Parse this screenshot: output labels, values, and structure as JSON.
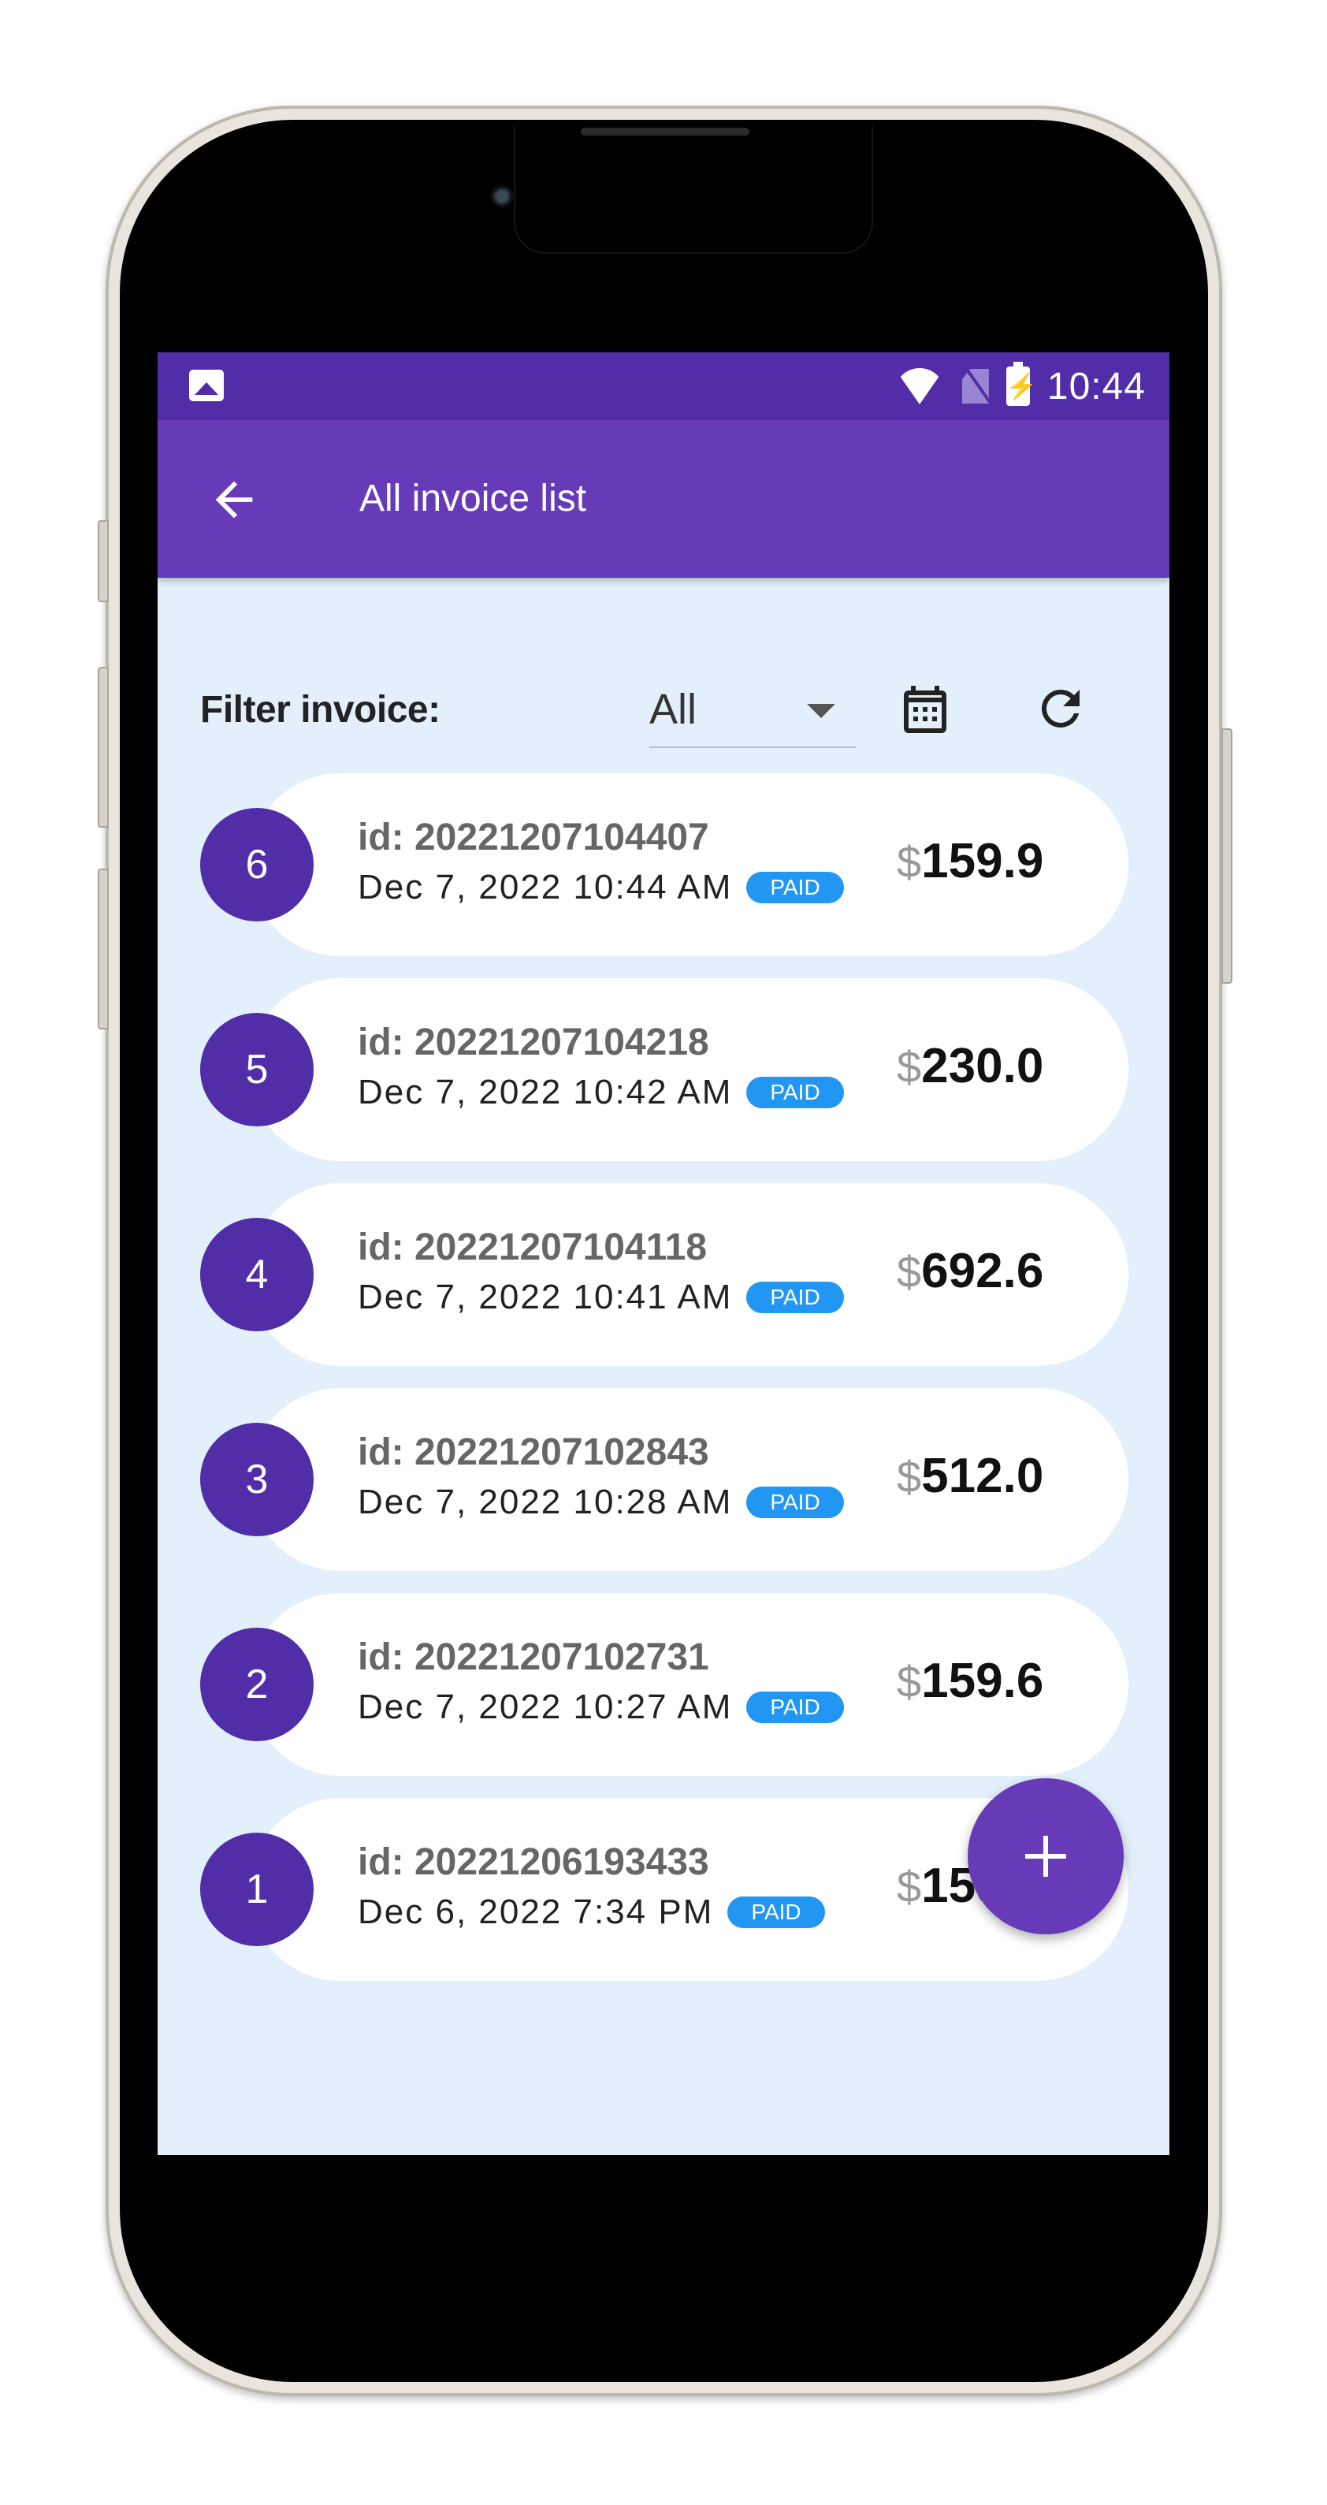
{
  "status_bar": {
    "time": "10:44",
    "icons": [
      "gallery-icon",
      "wifi-icon",
      "no-sim-icon",
      "battery-charging-icon"
    ]
  },
  "app_bar": {
    "title": "All invoice list",
    "back_icon": "arrow-back-icon"
  },
  "filter": {
    "label": "Filter invoice:",
    "selected": "All",
    "calendar_icon": "calendar-icon",
    "refresh_icon": "refresh-icon"
  },
  "invoices": [
    {
      "number": "6",
      "id": "id: 20221207104407",
      "date": "Dec 7, 2022 10:44 AM",
      "status": "PAID",
      "currency": "$",
      "amount": "159.9"
    },
    {
      "number": "5",
      "id": "id: 20221207104218",
      "date": "Dec 7, 2022 10:42 AM",
      "status": "PAID",
      "currency": "$",
      "amount": "230.0"
    },
    {
      "number": "4",
      "id": "id: 20221207104118",
      "date": "Dec 7, 2022 10:41 AM",
      "status": "PAID",
      "currency": "$",
      "amount": "692.6"
    },
    {
      "number": "3",
      "id": "id: 20221207102843",
      "date": "Dec 7, 2022 10:28 AM",
      "status": "PAID",
      "currency": "$",
      "amount": "512.0"
    },
    {
      "number": "2",
      "id": "id: 20221207102731",
      "date": "Dec 7, 2022 10:27 AM",
      "status": "PAID",
      "currency": "$",
      "amount": "159.6"
    },
    {
      "number": "1",
      "id": "id: 20221206193433",
      "date": "Dec 6, 2022 7:34 PM",
      "status": "PAID",
      "currency": "$",
      "amount": "159.9"
    }
  ],
  "fab": {
    "icon": "plus-icon"
  },
  "colors": {
    "primary": "#673ab7",
    "primary_dark": "#512da8",
    "background": "#e3f0fb",
    "paid_badge": "#2196f3"
  }
}
